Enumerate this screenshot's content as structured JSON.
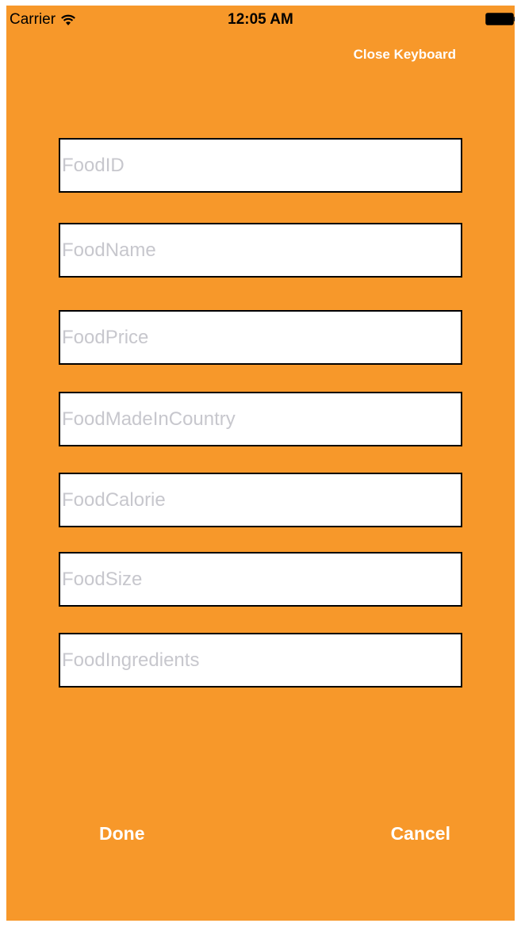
{
  "status_bar": {
    "carrier": "Carrier",
    "time": "12:05 AM",
    "wifi_icon": "wifi-icon",
    "battery_icon": "battery-full-icon"
  },
  "nav": {
    "close_keyboard_label": "Close Keyboard"
  },
  "form": {
    "fields": [
      {
        "placeholder": "FoodID",
        "value": ""
      },
      {
        "placeholder": "FoodName",
        "value": ""
      },
      {
        "placeholder": "FoodPrice",
        "value": ""
      },
      {
        "placeholder": "FoodMadeInCountry",
        "value": ""
      },
      {
        "placeholder": "FoodCalorie",
        "value": ""
      },
      {
        "placeholder": "FoodSize",
        "value": ""
      },
      {
        "placeholder": "FoodIngredients",
        "value": ""
      }
    ]
  },
  "actions": {
    "done_label": "Done",
    "cancel_label": "Cancel"
  },
  "colors": {
    "background": "#f7982a",
    "field_background": "#ffffff",
    "field_border": "#000000",
    "placeholder": "#c7c7cd",
    "button_text": "#ffffff"
  }
}
